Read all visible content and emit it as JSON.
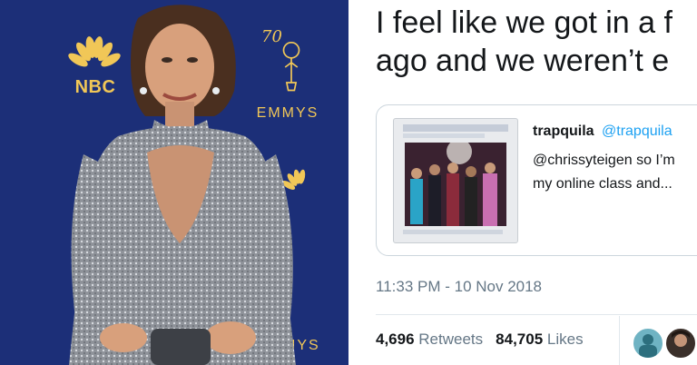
{
  "backdrop": {
    "nbc_label": "NBC",
    "emmys_label": "EMMYS",
    "emmys_number": "70"
  },
  "tweet": {
    "text_lines": [
      "I feel like we got in a f",
      "ago and we weren’t e"
    ],
    "quoted": {
      "name": "trapquila",
      "handle": "@trapquila",
      "body_lines": [
        "@chrissyteigen so I’m",
        "my online class and..."
      ]
    },
    "timestamp": "11:33 PM - 10 Nov 2018",
    "stats": {
      "retweets_count": "4,696",
      "retweets_label": "Retweets",
      "likes_count": "84,705",
      "likes_label": "Likes"
    }
  }
}
